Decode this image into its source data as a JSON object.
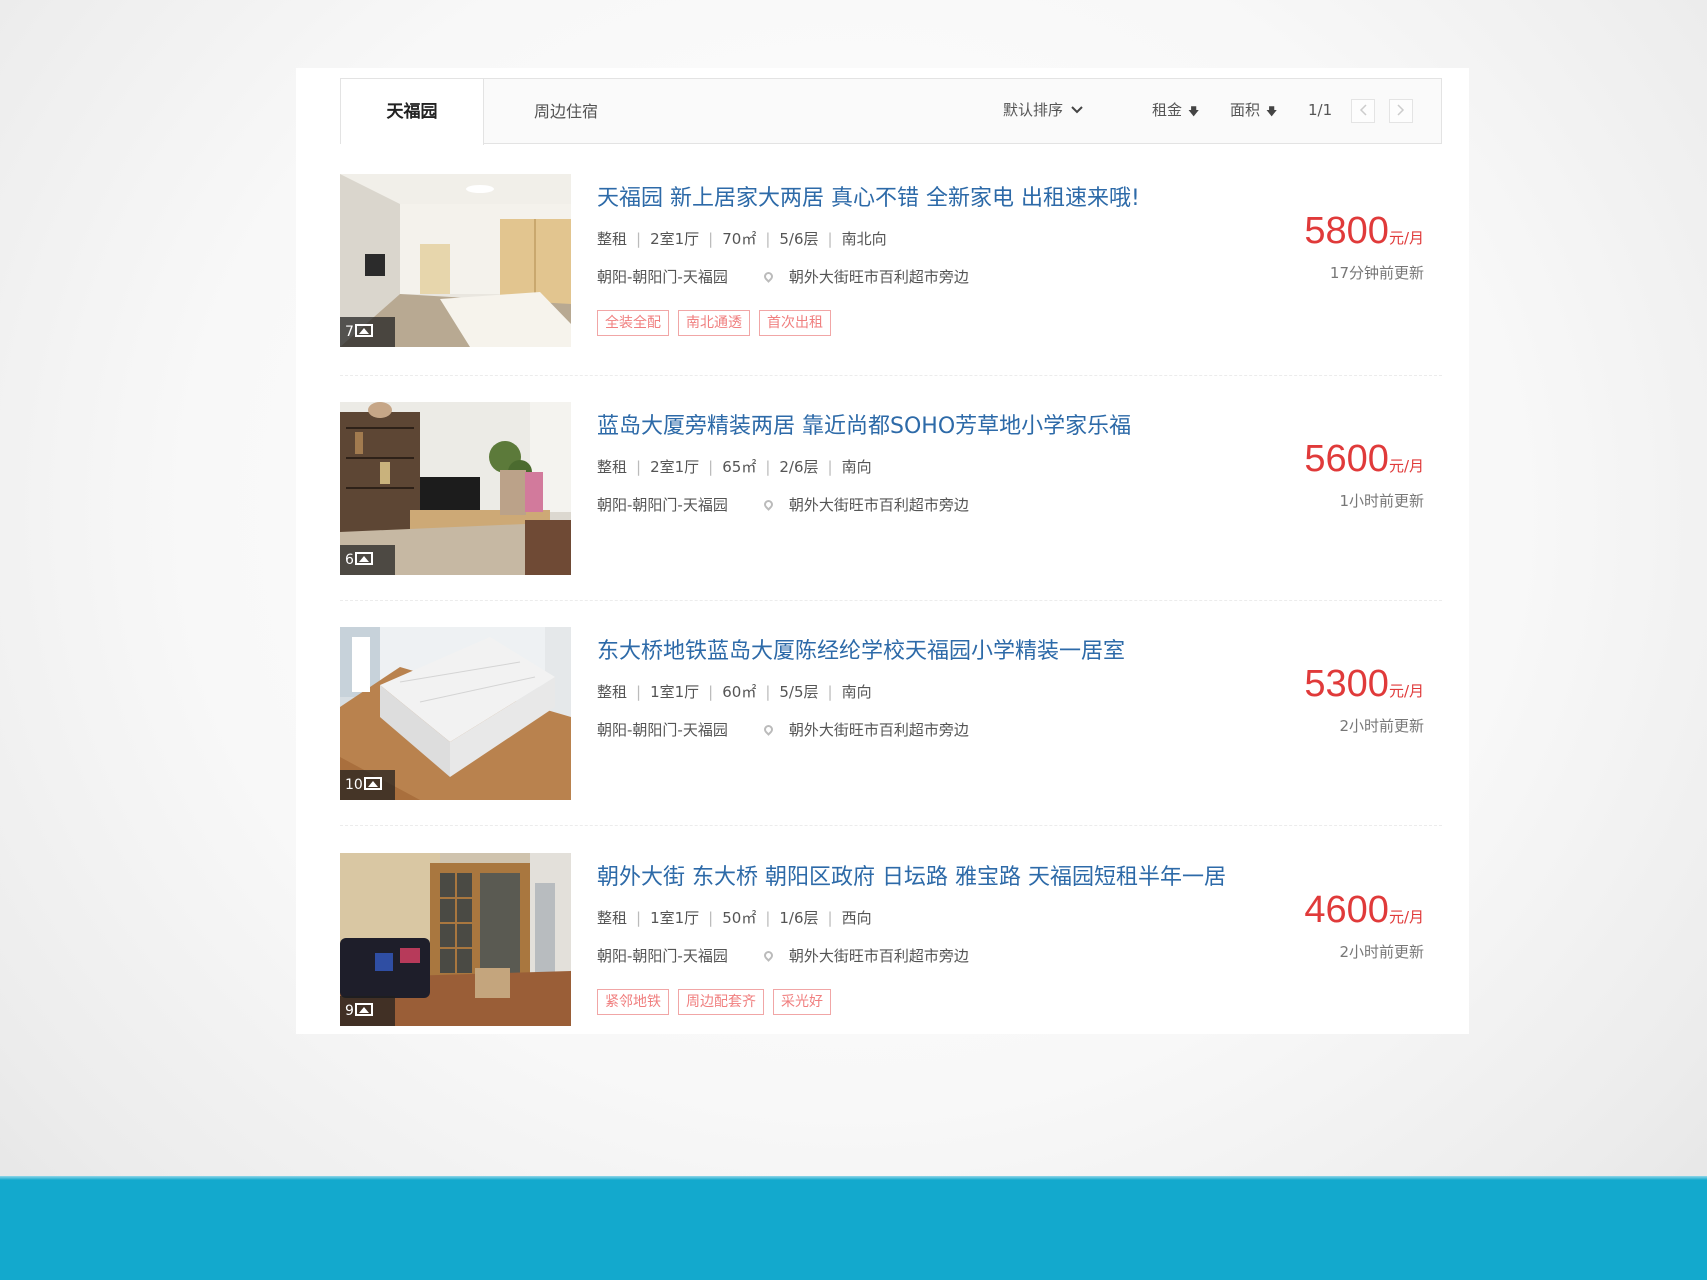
{
  "toolbar": {
    "tab_active": "天福园",
    "tab_nearby": "周边住宿",
    "sort_default": "默认排序",
    "sort_rent": "租金",
    "sort_area": "面积",
    "page": "1/1",
    "prev": "<",
    "next": ">"
  },
  "listings": [
    {
      "title": "天福园 新上居家大两居 真心不错 全新家电 出租速来哦!",
      "type": "整租",
      "rooms": "2室1厅",
      "area": "70㎡",
      "floor": "5/6层",
      "orientation": "南北向",
      "district": "朝阳-朝阳门-天福园",
      "address": "朝外大街旺市百利超市旁边",
      "tags": [
        "全装全配",
        "南北通透",
        "首次出租"
      ],
      "price": "5800",
      "unit": "元/月",
      "updated": "17分钟前更新",
      "photo_count": "7"
    },
    {
      "title": "蓝岛大厦旁精装两居 靠近尚都SOHO芳草地小学家乐福",
      "type": "整租",
      "rooms": "2室1厅",
      "area": "65㎡",
      "floor": "2/6层",
      "orientation": "南向",
      "district": "朝阳-朝阳门-天福园",
      "address": "朝外大街旺市百利超市旁边",
      "tags": [],
      "price": "5600",
      "unit": "元/月",
      "updated": "1小时前更新",
      "photo_count": "6"
    },
    {
      "title": "东大桥地铁蓝岛大厦陈经纶学校天福园小学精装一居室",
      "type": "整租",
      "rooms": "1室1厅",
      "area": "60㎡",
      "floor": "5/5层",
      "orientation": "南向",
      "district": "朝阳-朝阳门-天福园",
      "address": "朝外大街旺市百利超市旁边",
      "tags": [],
      "price": "5300",
      "unit": "元/月",
      "updated": "2小时前更新",
      "photo_count": "10"
    },
    {
      "title": "朝外大街 东大桥 朝阳区政府 日坛路 雅宝路 天福园短租半年一居",
      "type": "整租",
      "rooms": "1室1厅",
      "area": "50㎡",
      "floor": "1/6层",
      "orientation": "西向",
      "district": "朝阳-朝阳门-天福园",
      "address": "朝外大街旺市百利超市旁边",
      "tags": [
        "紧邻地铁",
        "周边配套齐",
        "采光好"
      ],
      "price": "4600",
      "unit": "元/月",
      "updated": "2小时前更新",
      "photo_count": "9"
    }
  ],
  "icons": {
    "image": "image-icon",
    "pin": "location-pin-icon",
    "chevron": "chevron-down-icon",
    "arrow": "arrow-down-icon"
  },
  "colors": {
    "title": "#2d6aa8",
    "price": "#e03a3a",
    "tag": "#f07f7f",
    "footer_bar": "#13a9cd"
  }
}
